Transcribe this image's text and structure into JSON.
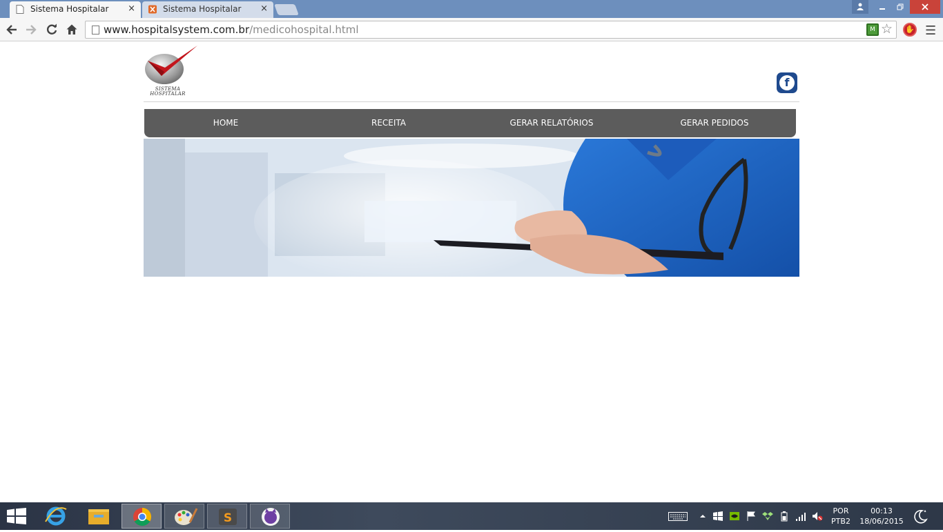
{
  "browser": {
    "tabs": [
      {
        "title": "Sistema Hospitalar",
        "close": "×"
      },
      {
        "title": "Sistema Hospitalar",
        "close": "×"
      }
    ],
    "url_host": "www.hospitalsystem.com.br",
    "url_path": "/medicohospital.html"
  },
  "logo": {
    "line1": "SISTEMA",
    "line2": "HOSPITALAR",
    "check_color": "#c3161d"
  },
  "social": {
    "facebook_glyph": "f",
    "color": "#1f4a8e"
  },
  "nav": {
    "items": [
      "HOME",
      "RECEITA",
      "GERAR RELATÓRIOS",
      "GERAR PEDIDOS"
    ],
    "background": "#5c5c5c"
  },
  "banner": {
    "scrub_color": "#1b63c9"
  },
  "taskbar": {
    "apps": [
      "internet-explorer-icon",
      "file-explorer-icon",
      "chrome-icon",
      "paint-icon",
      "sublime-text-icon",
      "github-icon"
    ],
    "language": "POR",
    "keyboard": "PTB2",
    "time": "00:13",
    "date": "18/06/2015"
  }
}
